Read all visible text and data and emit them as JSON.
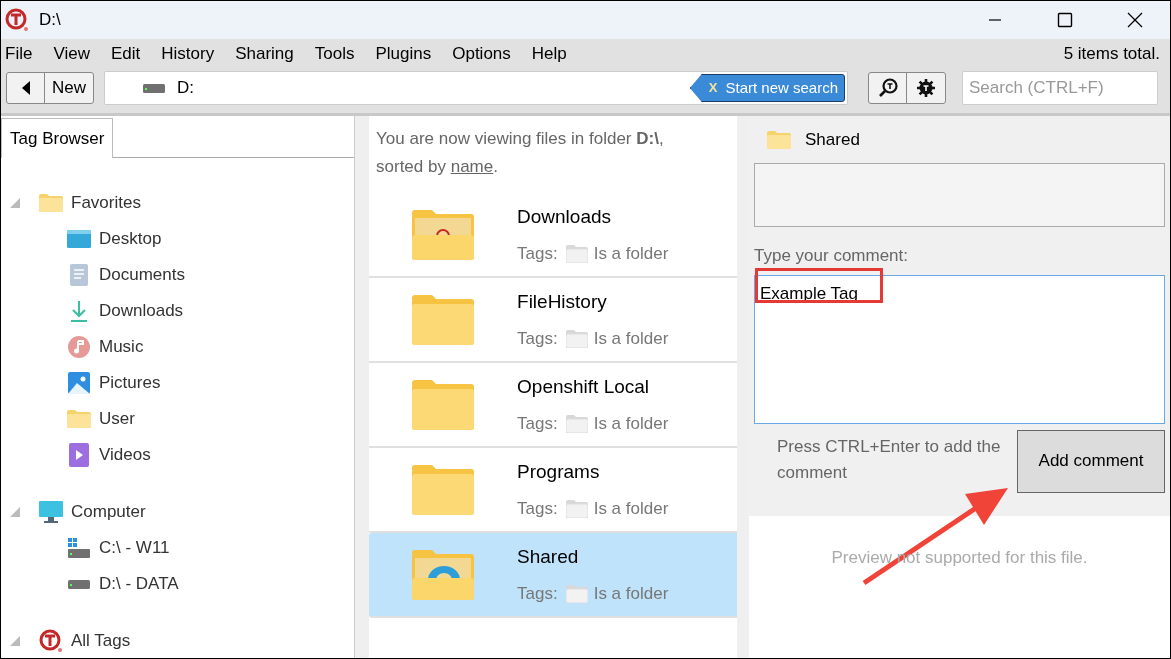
{
  "window": {
    "title": "D:\\"
  },
  "menu": [
    "File",
    "View",
    "Edit",
    "History",
    "Sharing",
    "Tools",
    "Plugins",
    "Options",
    "Help"
  ],
  "items_total": "5 items total.",
  "toolbar": {
    "new_button": "New",
    "location": "D:",
    "search_chip": "Start new search",
    "search_chip_close": "X",
    "search_placeholder": "Search (CTRL+F)"
  },
  "sidebar": {
    "tab": "Tag Browser",
    "tree": [
      {
        "label": "Favorites",
        "kind": "folder",
        "expanded": true,
        "children": [
          {
            "label": "Desktop",
            "kind": "desktop"
          },
          {
            "label": "Documents",
            "kind": "documents"
          },
          {
            "label": "Downloads",
            "kind": "downloads"
          },
          {
            "label": "Music",
            "kind": "music"
          },
          {
            "label": "Pictures",
            "kind": "pictures"
          },
          {
            "label": "User",
            "kind": "folder"
          },
          {
            "label": "Videos",
            "kind": "videos"
          }
        ]
      },
      {
        "label": "Computer",
        "kind": "computer",
        "expanded": true,
        "children": [
          {
            "label": "C:\\ - W11",
            "kind": "system-drive"
          },
          {
            "label": "D:\\ - DATA",
            "kind": "drive"
          }
        ]
      },
      {
        "label": "All Tags",
        "kind": "tags",
        "expanded": true
      }
    ]
  },
  "listing": {
    "header": "You are now viewing files in folder **D:\\**, sorted by",
    "sort_link": "name",
    "header_end": ".",
    "files": [
      {
        "name": "Downloads",
        "kind": "download-folder",
        "tags_label": "Tags:",
        "tag": "Is a folder",
        "selected": false
      },
      {
        "name": "FileHistory",
        "kind": "folder",
        "tags_label": "Tags:",
        "tag": "Is a folder",
        "selected": false
      },
      {
        "name": "Openshift Local",
        "kind": "folder",
        "tags_label": "Tags:",
        "tag": "Is a folder",
        "selected": false
      },
      {
        "name": "Programs",
        "kind": "folder",
        "tags_label": "Tags:",
        "tag": "Is a folder",
        "selected": false
      },
      {
        "name": "Shared",
        "kind": "shared-folder",
        "tags_label": "Tags:",
        "tag": "Is a folder",
        "selected": true
      }
    ]
  },
  "details": {
    "name": "Shared",
    "comment_label": "Type your comment:",
    "comment_value": "Example Tag",
    "hint": "Press CTRL+Enter to add the comment",
    "add_button": "Add comment",
    "preview": "Preview not supported for this file."
  }
}
